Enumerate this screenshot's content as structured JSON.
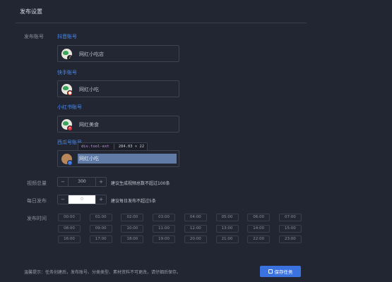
{
  "header": {
    "title": "发布设置"
  },
  "labels": {
    "accounts": "发布账号",
    "video_count": "视频总量",
    "daily": "每日发布",
    "times": "发布时间"
  },
  "accounts": [
    {
      "platform": "抖音账号",
      "nickname": "网红小吃店",
      "badge_color": "#222"
    },
    {
      "platform": "快手账号",
      "nickname": "网红小吃",
      "badge_color": "#e8542f"
    },
    {
      "platform": "小红书账号",
      "nickname": "网红美食",
      "badge_color": "#e0303a"
    },
    {
      "platform": "西瓜号账号",
      "nickname": "网红小吃",
      "badge_color": "#3a73e0"
    }
  ],
  "tooltip": {
    "name": "div.tool-ext",
    "size": "284.03 × 22"
  },
  "video_count": {
    "minus": "−",
    "value": "300",
    "plus": "+",
    "hint": "建议生成视频总数不超过100条"
  },
  "daily": {
    "minus": "−",
    "value": "0",
    "plus": "+",
    "hint": "建议每日发布不超过5条"
  },
  "times": [
    "00:00",
    "01:00",
    "02:00",
    "03:00",
    "04:00",
    "05:00",
    "06:00",
    "07:00",
    "08:00",
    "09:00",
    "10:00",
    "11:00",
    "12:00",
    "13:00",
    "14:00",
    "15:00",
    "16:00",
    "17:00",
    "18:00",
    "19:00",
    "20:00",
    "21:00",
    "22:00",
    "23:00"
  ],
  "footer": {
    "note": "温馨提示：任务创建后，发布账号、分类类型、素材资料不可更改，请仔细后保存。",
    "save_label": "保存任务"
  }
}
